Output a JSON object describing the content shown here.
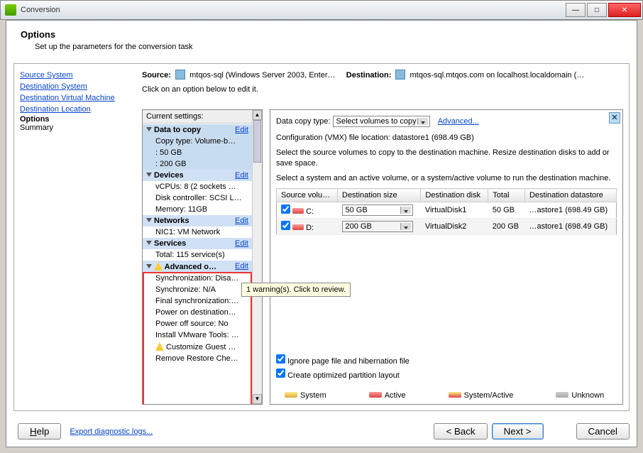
{
  "window": {
    "title": "Conversion"
  },
  "header": {
    "title": "Options",
    "subtitle": "Set up the parameters for the conversion task"
  },
  "nav": {
    "items": [
      {
        "label": "Source System",
        "link": true
      },
      {
        "label": "Destination System",
        "link": true
      },
      {
        "label": "Destination Virtual Machine",
        "link": true
      },
      {
        "label": "Destination Location",
        "link": true
      },
      {
        "label": "Options",
        "current": true
      },
      {
        "label": "Summary",
        "plain": true
      }
    ]
  },
  "sourceLabel": "Source:",
  "sourceValue": "mtqos-sql (Windows Server 2003, Enter…",
  "destLabel": "Destination:",
  "destValue": "mtqos-sql.mtqos.com on localhost.localdomain (…",
  "clickHint": "Click on an option below to edit it.",
  "settingsHeader": "Current settings:",
  "editLabel": "Edit",
  "settings": {
    "groups": [
      {
        "title": "Data to copy",
        "selected": true,
        "items": [
          "Copy type: Volume-b…",
          "<C:>: 50 GB",
          "<D:>: 200 GB"
        ]
      },
      {
        "title": "Devices",
        "items": [
          "vCPUs: 8 (2 sockets …",
          "Disk controller: SCSI L…",
          "Memory: 11GB"
        ]
      },
      {
        "title": "Networks",
        "items": [
          "NIC1: VM Network"
        ]
      },
      {
        "title": "Services",
        "items": [
          "Total: 115 service(s)"
        ]
      },
      {
        "title": "Advanced o…",
        "warn": true,
        "items": [
          "Synchronization: Disa…",
          "Synchronize: N/A",
          "Final synchronization:…",
          "Power on destination…",
          "Power off source: No",
          "Install VMware Tools: …",
          "Customize Guest …",
          "Remove Restore Che…"
        ],
        "itemWarn": [
          false,
          false,
          false,
          false,
          false,
          false,
          true,
          false
        ]
      }
    ]
  },
  "tooltip": "1 warning(s). Click to review.",
  "detail": {
    "dctLabel": "Data copy type:",
    "dctValue": "Select volumes to copy",
    "advLink": "Advanced...",
    "configLoc": "Configuration (VMX) file location: datastore1 (698.49 GB)",
    "desc1": "Select the source volumes to copy to the destination machine. Resize destination disks to add or save space.",
    "desc2": "Select a system and an active volume, or a system/active volume to run the destination machine.",
    "cols": [
      "Source volu…",
      "Destination size",
      "Destination disk",
      "Total",
      "Destination datastore"
    ],
    "rows": [
      {
        "checked": true,
        "vol": "C:",
        "size": "50 GB",
        "disk": "VirtualDisk1",
        "total": "50 GB",
        "store": "…astore1 (698.49 GB)"
      },
      {
        "checked": true,
        "vol": "D:",
        "size": "200 GB",
        "disk": "VirtualDisk2",
        "total": "200 GB",
        "store": "…astore1 (698.49 GB)"
      }
    ],
    "check1": "Ignore page file and hibernation file",
    "check2": "Create optimized partition layout",
    "legend": [
      "System",
      "Active",
      "System/Active",
      "Unknown"
    ]
  },
  "footer": {
    "help": "Help",
    "export": "Export diagnostic logs...",
    "back": "< Back",
    "next": "Next >",
    "cancel": "Cancel"
  }
}
